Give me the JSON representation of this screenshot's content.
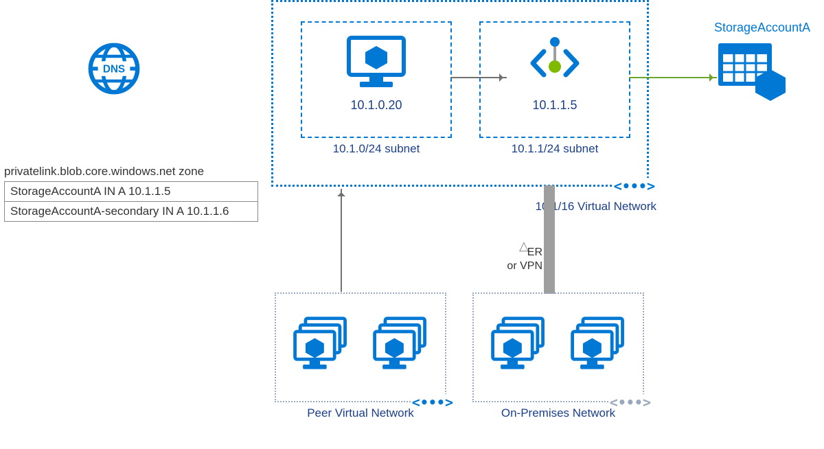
{
  "dns": {
    "zone_title": "privatelink.blob.core.windows.net zone",
    "records": [
      "StorageAccountA IN A 10.1.1.5",
      "StorageAccountA-secondary IN A 10.1.1.6"
    ],
    "badge": "DNS"
  },
  "vnet": {
    "label": "10.1/16 Virtual Network",
    "subnets": [
      {
        "ip": "10.1.0.20",
        "name": "10.1.0/24 subnet"
      },
      {
        "ip": "10.1.1.5",
        "name": "10.1.1/24 subnet"
      }
    ]
  },
  "storage": {
    "label": "StorageAccountA"
  },
  "peer": {
    "label": "Peer Virtual Network"
  },
  "onprem": {
    "label": "On-Premises Network"
  },
  "link": {
    "label": "ER\nor VPN"
  },
  "pin_glyph": "<•••>"
}
